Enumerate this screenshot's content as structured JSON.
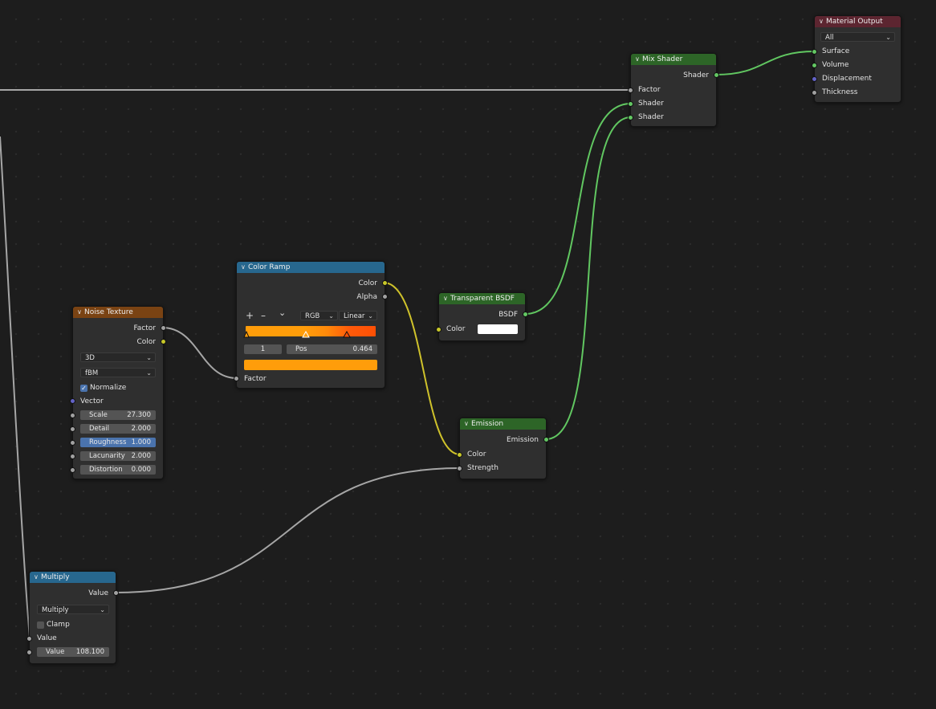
{
  "colors": {
    "background": "#1d1d1d",
    "node_body": "#2f2f2f",
    "header_texture": "#7a4313",
    "header_converter": "#27678e",
    "header_shader": "#2d6527",
    "header_output": "#5c2530",
    "socket_float": "#a1a1a1",
    "socket_color": "#c7c729",
    "socket_shader": "#63c763",
    "socket_vector": "#6363c7",
    "wire_float": "#a6a6a6",
    "wire_color": "#cfc22b",
    "wire_shader": "#61c761"
  },
  "nodes": {
    "noise_texture": {
      "title": "Noise Texture",
      "out_factor": "Factor",
      "out_color": "Color",
      "dimensions": "3D",
      "type": "fBM",
      "normalize_label": "Normalize",
      "normalize": true,
      "in_vector": "Vector",
      "fields": [
        {
          "label": "Scale",
          "value": "27.300"
        },
        {
          "label": "Detail",
          "value": "2.000"
        },
        {
          "label": "Roughness",
          "value": "1.000"
        },
        {
          "label": "Lacunarity",
          "value": "2.000"
        },
        {
          "label": "Distortion",
          "value": "0.000"
        }
      ]
    },
    "color_ramp": {
      "title": "Color Ramp",
      "out_color": "Color",
      "out_alpha": "Alpha",
      "add": "+",
      "remove": "–",
      "menu": "⌄",
      "color_mode": "RGB",
      "interpolation": "Linear",
      "active_stop": "1",
      "pos_label": "Pos",
      "pos_value": "0.464",
      "stop_color": "#ff9d0a",
      "in_factor": "Factor"
    },
    "transparent_bsdf": {
      "title": "Transparent BSDF",
      "out_bsdf": "BSDF",
      "in_color": "Color",
      "color": "#ffffff"
    },
    "emission": {
      "title": "Emission",
      "out_emission": "Emission",
      "in_color": "Color",
      "in_strength": "Strength"
    },
    "mix_shader": {
      "title": "Mix Shader",
      "out_shader": "Shader",
      "in_factor": "Factor",
      "in_shader1": "Shader",
      "in_shader2": "Shader"
    },
    "material_output": {
      "title": "Material Output",
      "target": "All",
      "in_surface": "Surface",
      "in_volume": "Volume",
      "in_displacement": "Displacement",
      "in_thickness": "Thickness"
    },
    "multiply": {
      "title": "Multiply",
      "out_value": "Value",
      "operation": "Multiply",
      "clamp_label": "Clamp",
      "clamp": false,
      "in_value": "Value",
      "value_label": "Value",
      "value": "108.100"
    }
  }
}
